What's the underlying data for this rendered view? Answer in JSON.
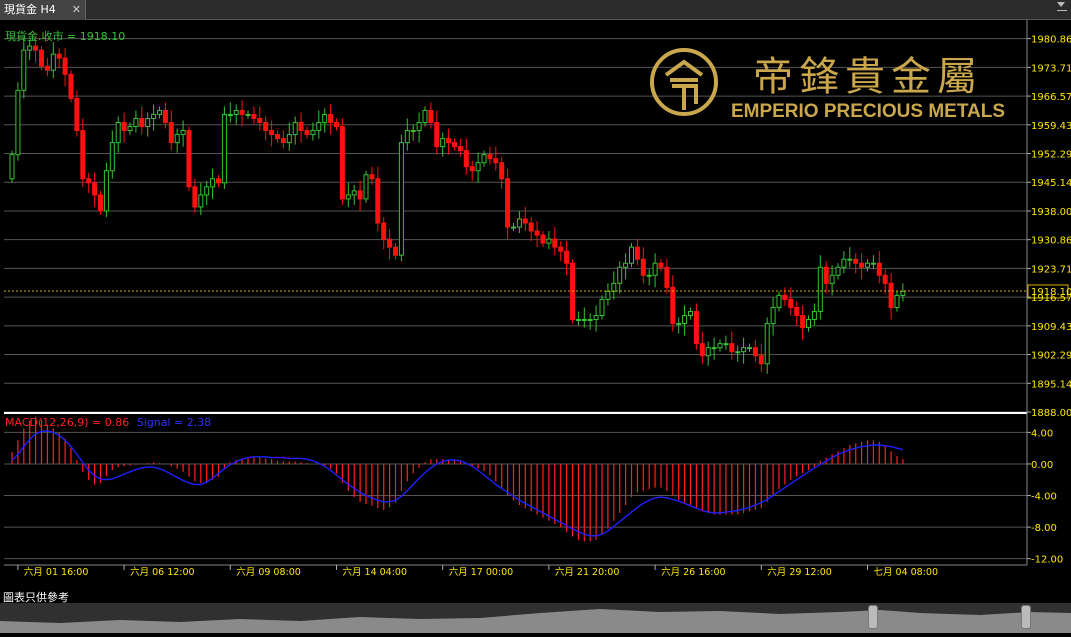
{
  "window": {
    "tab_title": "現貨金 H4",
    "close_glyph": "✕"
  },
  "header": {
    "symbol_label": "現貨金.收市 = 1918.10"
  },
  "logo": {
    "cn_text": "帝鋒貴金屬",
    "en_text": "EMPERIO PRECIOUS METALS",
    "color": "#c9a74a"
  },
  "macd_label": {
    "main": "MACD(12,26,9) = 0.86",
    "signal": "Signal = 2.38"
  },
  "footer": {
    "note": "圖表只供參考"
  },
  "colors": {
    "up": "#35c235",
    "down": "#ff1010",
    "macd_hist": "#ff2020",
    "signal": "#2020ff",
    "price_line": "#d8b000"
  },
  "chart_data": {
    "type": "candlestick",
    "price_axis": {
      "min": 1888.0,
      "max": 1984.0,
      "ticks": [
        "1980.86",
        "1973.71",
        "1966.57",
        "1959.43",
        "1952.29",
        "1945.14",
        "1938.00",
        "1930.86",
        "1923.71",
        "1916.57",
        "1909.43",
        "1902.29",
        "1895.14",
        "1888.00"
      ]
    },
    "current_price": "1918.10",
    "macd_axis": {
      "min": -12.8,
      "max": 6.2,
      "ticks": [
        "4.00",
        "0.00",
        "-4.00",
        "-8.00",
        "-12.00"
      ]
    },
    "x_labels": [
      "六月 01 16:00",
      "六月 06 12:00",
      "六月 09 08:00",
      "六月 14 04:00",
      "六月 17 00:00",
      "六月 21 20:00",
      "六月 26 16:00",
      "六月 29 12:00",
      "七月 04 08:00"
    ],
    "x_label_index": [
      1,
      19,
      37,
      55,
      73,
      91,
      109,
      127,
      145
    ],
    "close": [
      1952,
      1968,
      1978,
      1979,
      1978,
      1974,
      1973,
      1977,
      1976,
      1972,
      1966,
      1958,
      1946,
      1945,
      1942,
      1938,
      1948,
      1955,
      1960,
      1958,
      1959,
      1961,
      1959,
      1961,
      1962,
      1963,
      1960,
      1955,
      1957,
      1958,
      1944,
      1939,
      1942,
      1944,
      1946,
      1945,
      1962,
      1962,
      1963,
      1962,
      1962,
      1961,
      1960,
      1958,
      1957,
      1956,
      1955,
      1957,
      1960,
      1958,
      1957,
      1958,
      1960,
      1962,
      1960,
      1959,
      1941,
      1942,
      1943,
      1941,
      1947,
      1946,
      1935,
      1931,
      1929,
      1927,
      1955,
      1958,
      1958,
      1960,
      1963,
      1960,
      1954,
      1956,
      1955,
      1954,
      1953,
      1949,
      1948,
      1950,
      1952,
      1951,
      1950,
      1946,
      1934,
      1934,
      1936,
      1935,
      1933,
      1932,
      1930,
      1931,
      1929,
      1928,
      1925,
      1911,
      1911,
      1911,
      1911,
      1912,
      1916,
      1918,
      1920,
      1924,
      1925,
      1929,
      1926,
      1922,
      1922,
      1925,
      1924,
      1919,
      1910,
      1910,
      1912,
      1913,
      1905,
      1902,
      1904,
      1904,
      1905,
      1905,
      1903,
      1903,
      1904,
      1904,
      1902,
      1900,
      1910,
      1914,
      1917,
      1916,
      1914,
      1912,
      1909,
      1911,
      1913,
      1924,
      1920,
      1922,
      1924,
      1926,
      1926,
      1925,
      1924,
      1925,
      1925,
      1922,
      1920,
      1914,
      1917,
      1918
    ],
    "macd_hist": [
      1.5,
      3.0,
      4.5,
      5.5,
      6.0,
      5.6,
      5.0,
      4.5,
      4.0,
      3.2,
      2.0,
      0.5,
      -1.0,
      -2.0,
      -2.6,
      -2.4,
      -1.5,
      -0.8,
      -0.4,
      -0.3,
      -0.2,
      -0.1,
      0.0,
      0.1,
      0.2,
      0.1,
      0.0,
      -0.3,
      -0.6,
      -1.0,
      -1.6,
      -2.2,
      -2.4,
      -2.3,
      -2.0,
      -1.6,
      -0.5,
      0.2,
      0.5,
      0.6,
      0.7,
      0.8,
      0.8,
      0.7,
      0.6,
      0.4,
      0.3,
      0.3,
      0.3,
      0.2,
      0.1,
      0.0,
      0.0,
      -0.2,
      -0.6,
      -1.2,
      -2.4,
      -3.4,
      -4.2,
      -4.8,
      -5.1,
      -5.3,
      -5.6,
      -5.8,
      -5.5,
      -4.9,
      -3.4,
      -2.2,
      -1.2,
      -0.5,
      0.2,
      0.6,
      0.6,
      0.6,
      0.5,
      0.4,
      0.3,
      0.0,
      -0.3,
      -0.6,
      -0.9,
      -1.4,
      -2.2,
      -3.0,
      -4.0,
      -4.6,
      -5.2,
      -5.6,
      -6.0,
      -6.4,
      -6.8,
      -7.2,
      -7.6,
      -8.0,
      -8.6,
      -9.2,
      -9.6,
      -9.8,
      -9.8,
      -9.6,
      -9.0,
      -8.2,
      -7.2,
      -6.2,
      -5.2,
      -4.2,
      -3.6,
      -3.4,
      -3.2,
      -3.0,
      -3.0,
      -3.4,
      -4.0,
      -4.6,
      -5.0,
      -5.2,
      -5.6,
      -6.0,
      -6.2,
      -6.4,
      -6.4,
      -6.4,
      -6.4,
      -6.4,
      -6.2,
      -6.0,
      -5.8,
      -5.6,
      -4.8,
      -4.0,
      -3.2,
      -2.6,
      -2.0,
      -1.6,
      -1.2,
      -0.8,
      -0.4,
      0.4,
      0.8,
      1.2,
      1.6,
      2.0,
      2.4,
      2.6,
      2.8,
      3.0,
      3.0,
      2.8,
      2.4,
      1.6,
      1.0,
      0.6
    ],
    "signal": [
      0.5,
      1.2,
      2.2,
      3.1,
      3.8,
      4.1,
      4.2,
      4.0,
      3.6,
      3.0,
      2.2,
      1.2,
      0.2,
      -0.8,
      -1.5,
      -1.9,
      -2.0,
      -1.9,
      -1.6,
      -1.3,
      -1.0,
      -0.7,
      -0.5,
      -0.4,
      -0.4,
      -0.6,
      -0.9,
      -1.3,
      -1.7,
      -2.1,
      -2.4,
      -2.6,
      -2.6,
      -2.3,
      -1.8,
      -1.2,
      -0.6,
      -0.1,
      0.3,
      0.6,
      0.8,
      0.9,
      0.9,
      0.9,
      0.8,
      0.8,
      0.8,
      0.7,
      0.7,
      0.7,
      0.6,
      0.4,
      0.1,
      -0.3,
      -0.8,
      -1.4,
      -2.0,
      -2.6,
      -3.1,
      -3.6,
      -4.0,
      -4.3,
      -4.6,
      -4.8,
      -4.8,
      -4.6,
      -4.1,
      -3.4,
      -2.6,
      -1.8,
      -1.1,
      -0.5,
      0.0,
      0.3,
      0.5,
      0.5,
      0.4,
      0.1,
      -0.3,
      -0.8,
      -1.4,
      -2.0,
      -2.6,
      -3.1,
      -3.6,
      -4.1,
      -4.6,
      -5.0,
      -5.4,
      -5.8,
      -6.2,
      -6.6,
      -7.0,
      -7.4,
      -7.8,
      -8.2,
      -8.6,
      -8.9,
      -9.1,
      -9.1,
      -8.9,
      -8.5,
      -7.9,
      -7.3,
      -6.7,
      -6.1,
      -5.5,
      -5.0,
      -4.6,
      -4.3,
      -4.2,
      -4.3,
      -4.5,
      -4.7,
      -5.0,
      -5.3,
      -5.6,
      -5.9,
      -6.1,
      -6.2,
      -6.2,
      -6.1,
      -6.0,
      -5.9,
      -5.7,
      -5.5,
      -5.2,
      -4.9,
      -4.5,
      -4.0,
      -3.5,
      -3.0,
      -2.5,
      -2.0,
      -1.5,
      -1.0,
      -0.5,
      -0.1,
      0.4,
      0.8,
      1.2,
      1.5,
      1.8,
      2.0,
      2.2,
      2.3,
      2.4,
      2.4,
      2.3,
      2.2,
      2.0,
      1.8
    ]
  }
}
